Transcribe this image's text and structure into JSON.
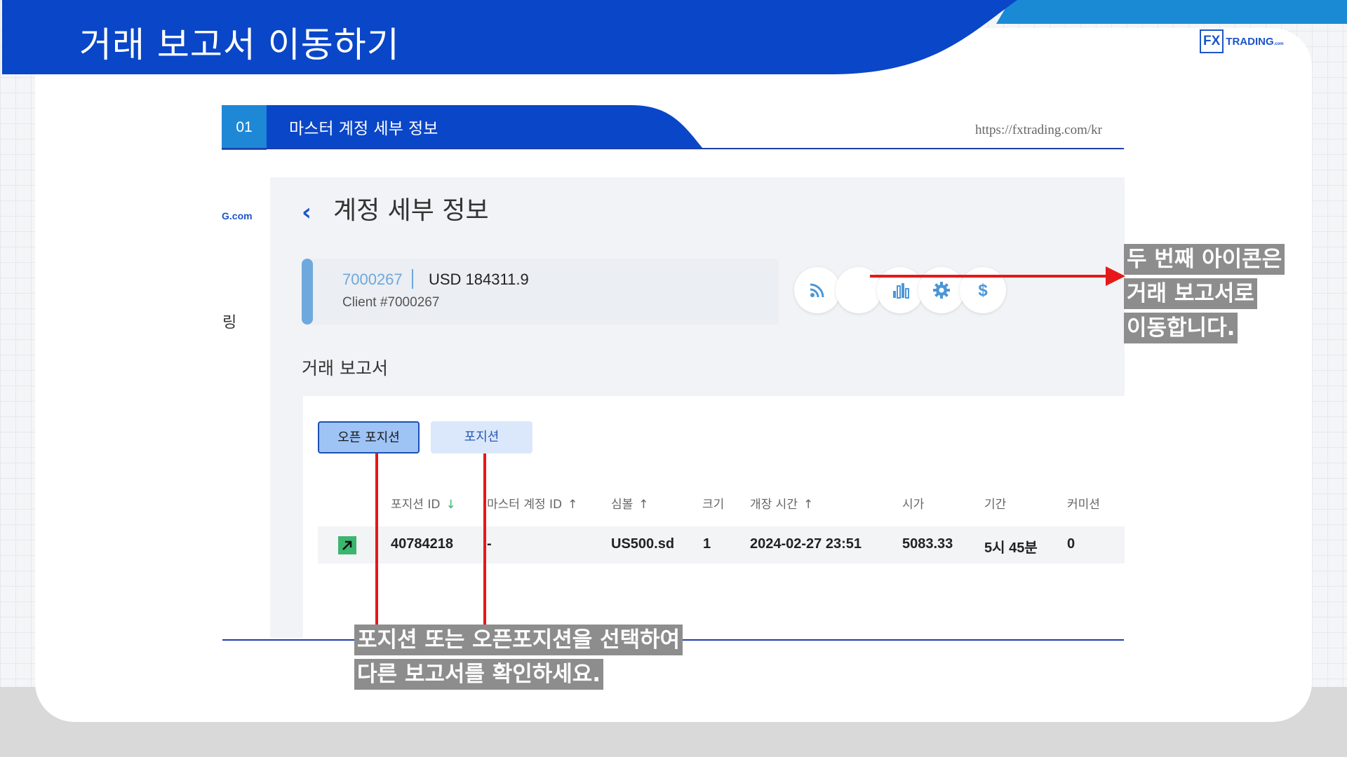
{
  "header": {
    "title": "거래 보고서 이동하기",
    "logo_box": "FX",
    "logo_text": "TRADING",
    "logo_suffix": ".com"
  },
  "section": {
    "number": "01",
    "label": "마스터 계정 세부 정보",
    "url": "https://fxtrading.com/kr"
  },
  "screenshot": {
    "sidebar_logo": "G.com",
    "sidebar_fragment": "링",
    "back_icon": "chevron-left-icon",
    "title": "계정 세부 정보",
    "account": {
      "id": "7000267",
      "balance": "USD 184311.9",
      "client": "Client #7000267"
    },
    "action_icons": [
      "rss-icon",
      "document-icon",
      "bar-chart-icon",
      "gear-icon",
      "dollar-icon"
    ],
    "active_icon_index": 1,
    "report_title": "거래 보고서",
    "tabs": {
      "open_positions": "오픈 포지션",
      "positions": "포지션"
    },
    "table": {
      "columns": [
        {
          "label": "포지션 ID",
          "sort": "↓"
        },
        {
          "label": "마스터 계정 ID",
          "sort": "↑"
        },
        {
          "label": "심볼",
          "sort": "↑"
        },
        {
          "label": "크기",
          "sort": ""
        },
        {
          "label": "개장 시간",
          "sort": "↑"
        },
        {
          "label": "시가",
          "sort": ""
        },
        {
          "label": "기간",
          "sort": ""
        },
        {
          "label": "커미션",
          "sort": ""
        }
      ],
      "rows": [
        {
          "direction_icon": "arrow-up-right-icon",
          "position_id": "40784218",
          "master_account_id": "-",
          "symbol": "US500.sd",
          "size": "1",
          "open_time": "2024-02-27 23:51",
          "open_price": "5083.33",
          "duration": "5시 45분",
          "commission": "0"
        }
      ]
    }
  },
  "callouts": {
    "right": {
      "line1": "두 번째 아이콘은",
      "line2": "거래 보고서로",
      "line3": "이동합니다."
    },
    "bottom": {
      "line1": "포지션 또는 오픈포지션을 선택하여",
      "line2": "다른 보고서를 확인하세요."
    }
  },
  "colors": {
    "header_blue": "#0a46c8",
    "accent_light_blue": "#1e88d6",
    "annotation_red": "#e51919",
    "callout_gray": "#8d8d8d"
  }
}
